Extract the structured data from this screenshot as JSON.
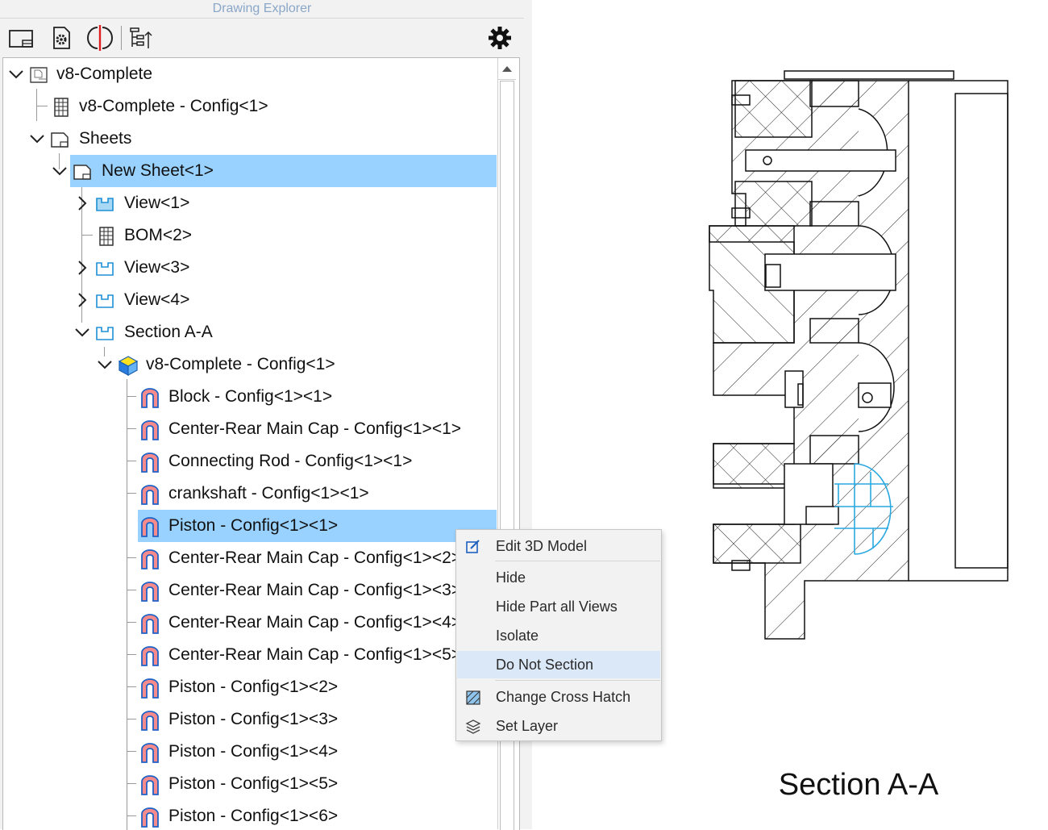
{
  "panel": {
    "title": "Drawing Explorer"
  },
  "toolbar": {
    "buttons": [
      "new-sheet-icon",
      "sheet-settings-icon",
      "section-icon",
      "tree-options-icon"
    ],
    "settings_icon": "gear-icon"
  },
  "tree": {
    "root": "v8-Complete",
    "config": "v8-Complete - Config<1>",
    "sheets": "Sheets",
    "sheet": "New Sheet<1>",
    "view1": "View<1>",
    "bom": "BOM<2>",
    "view3": "View<3>",
    "view4": "View<4>",
    "section": "Section A-A",
    "assembly": "v8-Complete - Config<1>",
    "parts": [
      "Block - Config<1><1>",
      "Center-Rear Main Cap - Config<1><1>",
      "Connecting Rod - Config<1><1>",
      "crankshaft - Config<1><1>",
      "Piston - Config<1><1>",
      "Center-Rear Main Cap - Config<1><2>",
      "Center-Rear Main Cap - Config<1><3>",
      "Center-Rear Main Cap - Config<1><4>",
      "Center-Rear Main Cap - Config<1><5>",
      "Piston - Config<1><2>",
      "Piston - Config<1><3>",
      "Piston - Config<1><4>",
      "Piston - Config<1><5>",
      "Piston - Config<1><6>"
    ]
  },
  "menu": {
    "edit_3d": "Edit 3D Model",
    "hide": "Hide",
    "hide_all": "Hide Part all Views",
    "isolate": "Isolate",
    "do_not_section": "Do Not Section",
    "change_hatch": "Change Cross Hatch",
    "set_layer": "Set Layer"
  },
  "drawing": {
    "caption": "Section A-A"
  },
  "colors": {
    "selection": "#99d1ff",
    "menu_active": "#dbe8f8",
    "highlight_part": "#29a8e0",
    "title": "#8aa6c8"
  }
}
